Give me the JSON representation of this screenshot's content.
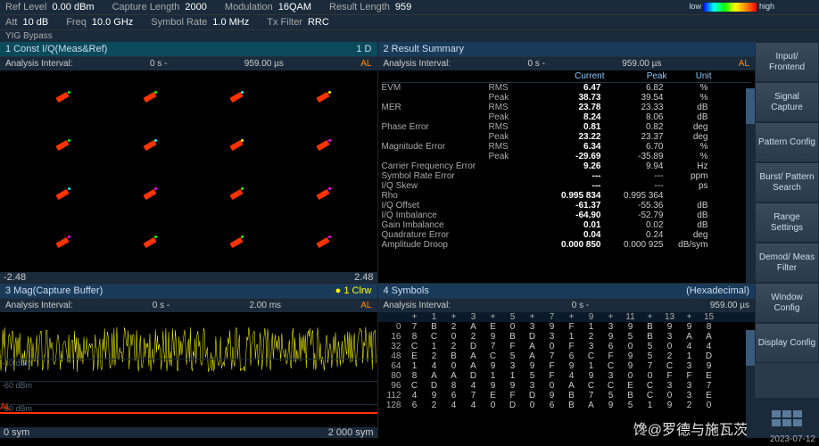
{
  "header": {
    "ref_level_label": "Ref Level",
    "ref_level": "0.00 dBm",
    "capture_len_label": "Capture Length",
    "capture_len": "2000",
    "modulation_label": "Modulation",
    "modulation": "16QAM",
    "result_len_label": "Result Length",
    "result_len": "959",
    "att_label": "Att",
    "att": "10 dB",
    "freq_label": "Freq",
    "freq": "10.0 GHz",
    "symbol_rate_label": "Symbol Rate",
    "symbol_rate": "1.0 MHz",
    "tx_filter_label": "Tx Filter",
    "tx_filter": "RRC",
    "yig": "YIG Bypass"
  },
  "menu": {
    "items": [
      "Input/\nFrontend",
      "Signal\nCapture",
      "Pattern\nConfig",
      "Burst/\nPattern\nSearch",
      "Range\nSettings",
      "Demod/\nMeas Filter",
      "Window\nConfig",
      "Display\nConfig"
    ]
  },
  "panel1": {
    "title": "1 Const I/Q(Meas&Ref)",
    "heat_low": "low",
    "heat_high": "high",
    "extra": "1 D",
    "analysis_label": "Analysis Interval:",
    "analysis_start": "0 s -",
    "analysis_end": "959.00 µs",
    "al": "AL",
    "x_min": "-2.48",
    "x_max": "2.48"
  },
  "panel2": {
    "title": "2 Result Summary",
    "analysis_label": "Analysis Interval:",
    "analysis_start": "0 s -",
    "analysis_end": "959.00 µs",
    "al": "AL",
    "hdr": {
      "current": "Current",
      "peak": "Peak",
      "unit": "Unit"
    },
    "rows": [
      {
        "name": "EVM",
        "sub": "RMS",
        "cur": "6.47",
        "peak": "6.82",
        "unit": "%"
      },
      {
        "name": "",
        "sub": "Peak",
        "cur": "38.73",
        "peak": "39.54",
        "unit": "%"
      },
      {
        "name": "MER",
        "sub": "RMS",
        "cur": "23.78",
        "peak": "23.33",
        "unit": "dB"
      },
      {
        "name": "",
        "sub": "Peak",
        "cur": "8.24",
        "peak": "8.06",
        "unit": "dB"
      },
      {
        "name": "Phase Error",
        "sub": "RMS",
        "cur": "0.81",
        "peak": "0.82",
        "unit": "deg"
      },
      {
        "name": "",
        "sub": "Peak",
        "cur": "23.22",
        "peak": "23.37",
        "unit": "deg"
      },
      {
        "name": "Magnitude Error",
        "sub": "RMS",
        "cur": "6.34",
        "peak": "6.70",
        "unit": "%"
      },
      {
        "name": "",
        "sub": "Peak",
        "cur": "-29.69",
        "peak": "-35.89",
        "unit": "%"
      },
      {
        "name": "Carrier Frequency Error",
        "sub": "",
        "cur": "9.26",
        "peak": "9.94",
        "unit": "Hz"
      },
      {
        "name": "Symbol Rate Error",
        "sub": "",
        "cur": "---",
        "peak": "---",
        "unit": "ppm"
      },
      {
        "name": "I/Q Skew",
        "sub": "",
        "cur": "---",
        "peak": "---",
        "unit": "ps"
      },
      {
        "name": "Rho",
        "sub": "",
        "cur": "0.995 834",
        "peak": "0.995 364",
        "unit": ""
      },
      {
        "name": "I/Q Offset",
        "sub": "",
        "cur": "-61.37",
        "peak": "-55.36",
        "unit": "dB"
      },
      {
        "name": "I/Q Imbalance",
        "sub": "",
        "cur": "-64.90",
        "peak": "-52.79",
        "unit": "dB"
      },
      {
        "name": "Gain Imbalance",
        "sub": "",
        "cur": "0.01",
        "peak": "0.02",
        "unit": "dB"
      },
      {
        "name": "Quadrature Error",
        "sub": "",
        "cur": "0.04",
        "peak": "0.24",
        "unit": "deg"
      },
      {
        "name": "Amplitude Droop",
        "sub": "",
        "cur": "0.000 850",
        "peak": "0.000 925",
        "unit": "dB/sym"
      }
    ]
  },
  "panel3": {
    "title": "3 Mag(Capture Buffer)",
    "trace": "● 1 Clrw",
    "analysis_label": "Analysis Interval:",
    "analysis_start": "0 s -",
    "analysis_end": "2.00 ms",
    "al": "AL",
    "labels": [
      "-40 dBm",
      "-60 dBm",
      "-80 dBm"
    ],
    "al_txt": "AL",
    "x_min": "0 sym",
    "x_max": "2 000 sym"
  },
  "panel4": {
    "title": "4 Symbols",
    "format": "(Hexadecimal)",
    "analysis_label": "Analysis Interval:",
    "analysis_start": "0 s -",
    "analysis_end": "959.00 µs",
    "cols": [
      "+",
      "1",
      "+",
      "3",
      "+",
      "5",
      "+",
      "7",
      "+",
      "9",
      "+",
      "11",
      "+",
      "13",
      "+",
      "15"
    ],
    "rows": [
      {
        "idx": "0",
        "vals": [
          "7",
          "B",
          "2",
          "A",
          "E",
          "0",
          "3",
          "9",
          "F",
          "1",
          "3",
          "9",
          "B",
          "9",
          "9",
          "8"
        ]
      },
      {
        "idx": "16",
        "vals": [
          "8",
          "C",
          "0",
          "2",
          "9",
          "B",
          "D",
          "3",
          "1",
          "2",
          "9",
          "5",
          "B",
          "3",
          "A",
          "A"
        ]
      },
      {
        "idx": "32",
        "vals": [
          "C",
          "1",
          "2",
          "D",
          "7",
          "F",
          "A",
          "0",
          "F",
          "3",
          "6",
          "0",
          "5",
          "0",
          "4",
          "4"
        ]
      },
      {
        "idx": "48",
        "vals": [
          "E",
          "2",
          "B",
          "A",
          "C",
          "5",
          "A",
          "7",
          "6",
          "C",
          "F",
          "9",
          "5",
          "2",
          "1",
          "D"
        ]
      },
      {
        "idx": "64",
        "vals": [
          "1",
          "4",
          "0",
          "A",
          "9",
          "3",
          "9",
          "F",
          "9",
          "1",
          "C",
          "9",
          "7",
          "C",
          "3",
          "9"
        ]
      },
      {
        "idx": "80",
        "vals": [
          "8",
          "A",
          "A",
          "D",
          "1",
          "1",
          "5",
          "F",
          "4",
          "9",
          "3",
          "0",
          "0",
          "F",
          "F",
          "E"
        ]
      },
      {
        "idx": "96",
        "vals": [
          "C",
          "D",
          "8",
          "4",
          "9",
          "9",
          "3",
          "0",
          "A",
          "C",
          "C",
          "E",
          "C",
          "3",
          "3",
          "7"
        ]
      },
      {
        "idx": "112",
        "vals": [
          "4",
          "9",
          "6",
          "7",
          "E",
          "F",
          "D",
          "9",
          "B",
          "7",
          "5",
          "B",
          "C",
          "0",
          "3",
          "E"
        ]
      },
      {
        "idx": "128",
        "vals": [
          "6",
          "2",
          "4",
          "4",
          "0",
          "D",
          "0",
          "6",
          "B",
          "A",
          "9",
          "5",
          "1",
          "9",
          "2",
          "0"
        ]
      }
    ]
  },
  "watermark": "馋@罗德与施瓦茨",
  "date": "2023-07-12"
}
